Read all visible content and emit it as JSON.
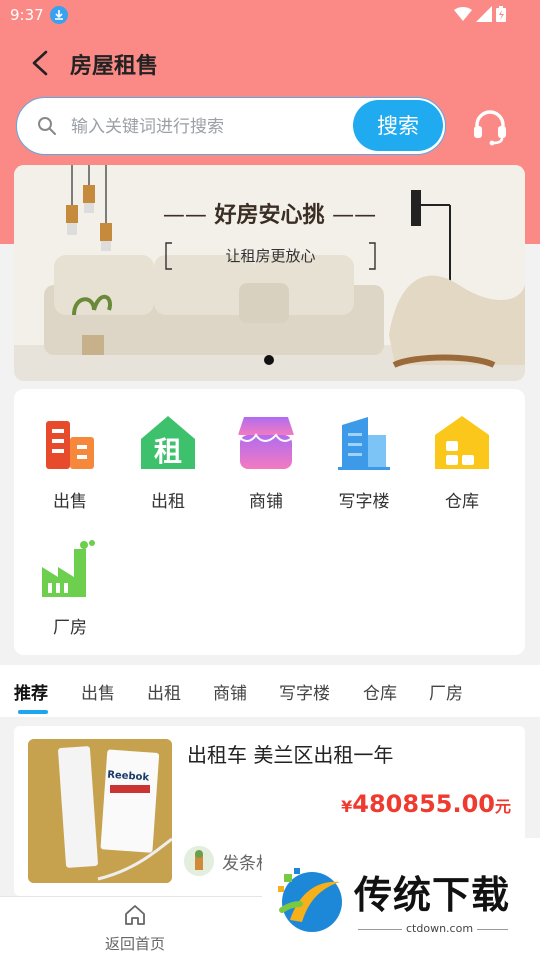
{
  "status_bar": {
    "time": "9:37"
  },
  "header": {
    "title": "房屋租售"
  },
  "search": {
    "placeholder": "输入关键词进行搜索",
    "button_label": "搜索"
  },
  "banner": {
    "headline": "好房安心挑",
    "subline": "让租房更放心"
  },
  "categories": [
    {
      "label": "出售",
      "icon": "building-icon"
    },
    {
      "label": "出租",
      "icon": "rent-house-icon"
    },
    {
      "label": "商铺",
      "icon": "shop-icon"
    },
    {
      "label": "写字楼",
      "icon": "office-building-icon"
    },
    {
      "label": "仓库",
      "icon": "warehouse-icon"
    },
    {
      "label": "厂房",
      "icon": "factory-icon"
    }
  ],
  "tabs": [
    {
      "label": "推荐",
      "active": true
    },
    {
      "label": "出售"
    },
    {
      "label": "出租"
    },
    {
      "label": "商铺"
    },
    {
      "label": "写字楼"
    },
    {
      "label": "仓库"
    },
    {
      "label": "厂房"
    }
  ],
  "listing": {
    "title": "出租车  美兰区出租一年",
    "price_currency": "¥",
    "price_value": "480855.00",
    "price_unit": "元",
    "author": "发条村",
    "image_text": "Reebok"
  },
  "bottom_nav": {
    "home_label": "返回首页"
  },
  "watermark": {
    "brand": "传统下载",
    "url": "ctdown.com"
  },
  "colors": {
    "header_bg": "#fb8a86",
    "accent_blue": "#20aaf0",
    "price_red": "#ef3a30"
  }
}
